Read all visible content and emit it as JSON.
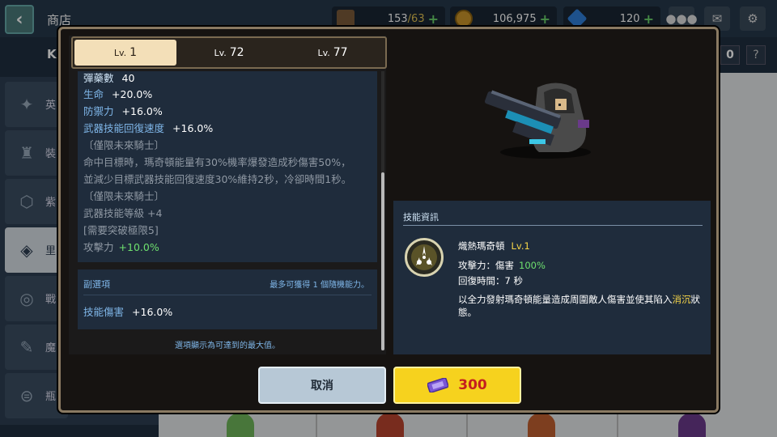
{
  "header": {
    "back_icon": "chevron-left-icon",
    "title": "商店",
    "stamina": {
      "icon": "coffee-icon",
      "current": "153",
      "max": "/63"
    },
    "coins": {
      "icon": "coin-icon",
      "value": "106,975"
    },
    "gems": {
      "icon": "gem-icon",
      "value": "120"
    },
    "plus": "+",
    "buttons": [
      "chat-icon",
      "mail-icon",
      "gear-icon"
    ]
  },
  "background": {
    "heading": "KI",
    "count_badge": "0",
    "help": "?",
    "sidebar": [
      {
        "label": "英",
        "icon": "hero-icon"
      },
      {
        "label": "裝",
        "icon": "equipment-icon"
      },
      {
        "label": "紫",
        "icon": "gem-badge-icon"
      },
      {
        "label": "里",
        "icon": "ticket-icon",
        "active": true
      },
      {
        "label": "戰",
        "icon": "medal-icon"
      },
      {
        "label": "魔",
        "icon": "magic-icon"
      },
      {
        "label": "瓶",
        "icon": "bottle-icon"
      }
    ]
  },
  "modal": {
    "tabs": [
      {
        "lv": "Lv.",
        "num": "1",
        "active": true
      },
      {
        "lv": "Lv.",
        "num": "72",
        "active": false
      },
      {
        "lv": "Lv.",
        "num": "77",
        "active": false
      }
    ],
    "stats": [
      {
        "label": "彈藥數",
        "value": "40"
      },
      {
        "label": "生命",
        "value": "+20.0%"
      },
      {
        "label": "防禦力",
        "value": "+16.0%"
      },
      {
        "label": "武器技能回復速度",
        "value": "+16.0%"
      }
    ],
    "gray_lines": [
      "〔僅限未來騎士〕",
      "命中目標時，瑪奇頓能量有30%機率爆發造成秒傷害50%，",
      "並減少目標武器技能回復速度30%維持2秒，冷卻時間1秒。",
      "〔僅限未來騎士〕",
      "武器技能等級  +4",
      "[需要突破極限5]"
    ],
    "attack": {
      "label": "攻擊力",
      "value": "+10.0%"
    },
    "sub_options": {
      "heading": "副選項",
      "note": "最多可獲得  1  個隨機能力。",
      "stat_label": "技能傷害",
      "stat_value": "+16.0%"
    },
    "footnote": "選項顯示為可達到的最大值。",
    "skill": {
      "heading": "技能資訊",
      "icon": "spark-emblem-icon",
      "name": "熾熱瑪奇頓",
      "lv": "Lv.1",
      "attack_label": "攻擊力：傷害",
      "attack_value": "100%",
      "cooldown": "回復時間：7  秒",
      "desc_pre": "以全力發射瑪奇頓能量造成周圍敵人傷害並使其陷入",
      "desc_highlight": "消沉",
      "desc_post": "狀態。"
    },
    "cancel_label": "取消",
    "buy_price": "300",
    "buy_icon": "ticket-icon",
    "colors": {
      "accent_yellow": "#f6d21e",
      "price_red": "#c41f1f",
      "stat_blue": "#7fb6e8",
      "bonus_green": "#6ee06e"
    }
  }
}
